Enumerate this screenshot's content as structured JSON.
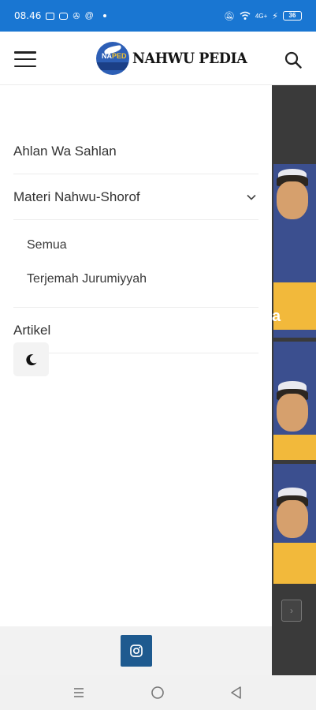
{
  "status_bar": {
    "time": "08.46",
    "battery": "36",
    "network": "4G+"
  },
  "header": {
    "logo_text": "NAHWU PEDIA",
    "logo_badge_text_a": "NA",
    "logo_badge_text_b": "PED",
    "menu_icon": "hamburger-menu-icon",
    "search_icon": "search-icon"
  },
  "drawer": {
    "items": [
      {
        "label": "Ahlan Wa Sahlan"
      },
      {
        "label": "Materi Nahwu-Shorof",
        "expanded": true,
        "children": [
          {
            "label": "Semua"
          },
          {
            "label": "Terjemah Jurumiyyah"
          }
        ]
      },
      {
        "label": "Artikel"
      }
    ],
    "theme_toggle_icon": "moon-icon",
    "footer_icon": "instagram-icon"
  },
  "background_page": {
    "visible_letter": "a"
  },
  "colors": {
    "status_bar": "#1976d2",
    "instagram_button": "#1e5a8f",
    "background_overlay": "#3a3a3a"
  }
}
